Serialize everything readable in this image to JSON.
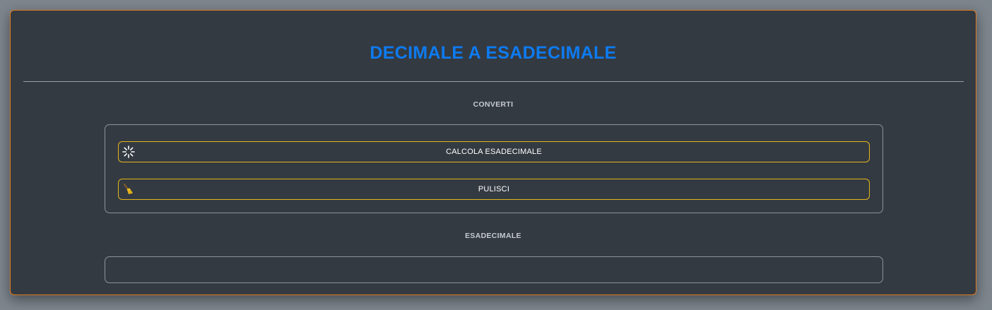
{
  "header": {
    "title": "DECIMALE A ESADECIMALE"
  },
  "convert_section": {
    "label": "CONVERTI",
    "calculate_button": {
      "label": "CALCOLA ESADECIMALE",
      "icon": "spinner-icon"
    },
    "clear_button": {
      "label": "PULISCI",
      "icon": "broom-icon"
    }
  },
  "output_section": {
    "label": "ESADECIMALE",
    "value": ""
  },
  "colors": {
    "title": "#0d7bf0",
    "card_border": "#e07a1f",
    "button_border": "#e3b61a",
    "card_background": "#343a42",
    "page_background": "#7d858d"
  }
}
